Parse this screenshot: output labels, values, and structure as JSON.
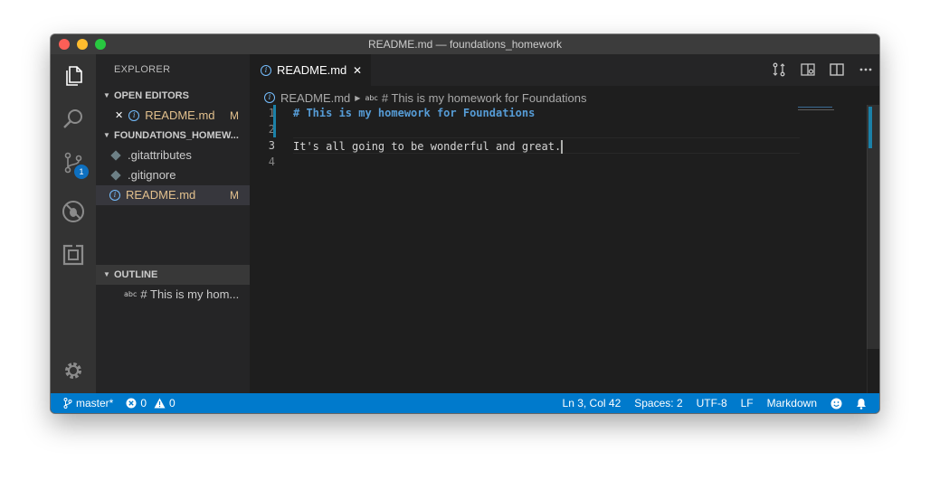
{
  "window": {
    "title": "README.md — foundations_homework"
  },
  "activity_bar": {
    "items": [
      "files-icon",
      "search-icon",
      "source-control-icon",
      "debug-icon",
      "extensions-icon",
      "gear-icon"
    ],
    "scm_badge": "1"
  },
  "sidebar": {
    "title": "EXPLORER",
    "open_editors": {
      "header": "OPEN EDITORS",
      "items": [
        {
          "close": "✕",
          "name": "README.md",
          "status": "M"
        }
      ]
    },
    "folder": {
      "header": "FOUNDATIONS_HOMEW...",
      "items": [
        {
          "name": ".gitattributes",
          "status": ""
        },
        {
          "name": ".gitignore",
          "status": ""
        },
        {
          "name": "README.md",
          "status": "M"
        }
      ]
    },
    "outline": {
      "header": "OUTLINE",
      "items": [
        {
          "name": "# This is my hom..."
        }
      ]
    }
  },
  "editor": {
    "tab": {
      "label": "README.md",
      "close": "✕"
    },
    "breadcrumb": {
      "file": "README.md",
      "symbol": "# This is my homework for Foundations"
    },
    "line_numbers": [
      "1",
      "2",
      "3",
      "4"
    ],
    "lines": [
      "# This is my homework for Foundations",
      "",
      "It's all going to be wonderful and great.",
      ""
    ],
    "active_line": 3
  },
  "status_bar": {
    "branch": "master*",
    "errors": "0",
    "warnings": "0",
    "position": "Ln 3, Col 42",
    "spaces": "Spaces: 2",
    "encoding": "UTF-8",
    "eol": "LF",
    "language": "Markdown"
  },
  "colors": {
    "status_bar": "#007acc",
    "heading": "#569cd6",
    "modified": "#e2c08d"
  }
}
